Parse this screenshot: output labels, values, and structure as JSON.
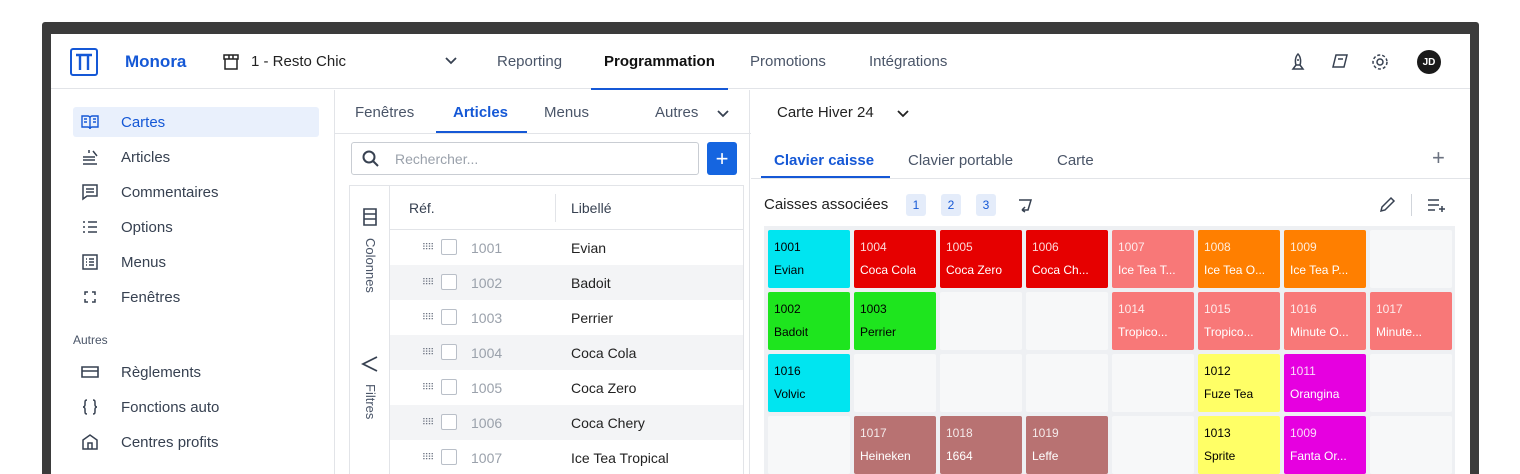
{
  "app": {
    "brand": "Monora",
    "store": "1 - Resto Chic",
    "avatar_initials": "JD"
  },
  "nav": [
    "Reporting",
    "Programmation",
    "Promotions",
    "Intégrations"
  ],
  "sidebar": {
    "items": [
      {
        "label": "Cartes",
        "icon": "book-open-icon",
        "active": true
      },
      {
        "label": "Articles",
        "icon": "dish-icon"
      },
      {
        "label": "Commentaires",
        "icon": "comment-icon"
      },
      {
        "label": "Options",
        "icon": "list-icon"
      },
      {
        "label": "Menus",
        "icon": "menu-card-icon"
      },
      {
        "label": "Fenêtres",
        "icon": "frame-corners-icon"
      }
    ],
    "section": "Autres",
    "other_items": [
      {
        "label": "Règlements",
        "icon": "credit-card-icon"
      },
      {
        "label": "Fonctions auto",
        "icon": "braces-icon"
      },
      {
        "label": "Centres profits",
        "icon": "building-icon"
      }
    ]
  },
  "middle": {
    "tabs": [
      "Fenêtres",
      "Articles",
      "Menus"
    ],
    "more_tab": "Autres",
    "search_placeholder": "Rechercher...",
    "columns_label": "Colonnes",
    "filters_label": "Filtres",
    "headers": {
      "ref": "Réf.",
      "label": "Libellé"
    },
    "rows": [
      {
        "ref": "1001",
        "label": "Evian"
      },
      {
        "ref": "1002",
        "label": "Badoit"
      },
      {
        "ref": "1003",
        "label": "Perrier"
      },
      {
        "ref": "1004",
        "label": "Coca Cola"
      },
      {
        "ref": "1005",
        "label": "Coca Zero"
      },
      {
        "ref": "1006",
        "label": "Coca Chery"
      },
      {
        "ref": "1007",
        "label": "Ice Tea Tropical"
      }
    ]
  },
  "right": {
    "menu_title": "Carte Hiver 24",
    "tabs": [
      "Clavier caisse",
      "Clavier portable",
      "Carte"
    ],
    "caisses_label": "Caisses associées",
    "caisses": [
      "1",
      "2",
      "3"
    ],
    "grid": [
      [
        {
          "code": "1001",
          "name": "Evian",
          "bg": "#00e5f0",
          "fg": "#000000"
        },
        {
          "code": "1004",
          "name": "Coca Cola",
          "bg": "#e60000",
          "fg": "#ffffff"
        },
        {
          "code": "1005",
          "name": "Coca Zero",
          "bg": "#e60000",
          "fg": "#ffffff"
        },
        {
          "code": "1006",
          "name": "Coca Ch...",
          "bg": "#e60000",
          "fg": "#ffffff"
        },
        {
          "code": "1007",
          "name": "Ice Tea T...",
          "bg": "#f87878",
          "fg": "#ffffff"
        },
        {
          "code": "1008",
          "name": "Ice Tea O...",
          "bg": "#ff7f00",
          "fg": "#ffffff"
        },
        {
          "code": "1009",
          "name": "Ice Tea P...",
          "bg": "#ff7f00",
          "fg": "#ffffff"
        },
        null
      ],
      [
        {
          "code": "1002",
          "name": "Badoit",
          "bg": "#1ee51e",
          "fg": "#000000"
        },
        {
          "code": "1003",
          "name": "Perrier",
          "bg": "#1ee51e",
          "fg": "#000000"
        },
        null,
        null,
        {
          "code": "1014",
          "name": "Tropico...",
          "bg": "#f87878",
          "fg": "#ffffff"
        },
        {
          "code": "1015",
          "name": "Tropico...",
          "bg": "#f87878",
          "fg": "#ffffff"
        },
        {
          "code": "1016",
          "name": "Minute O...",
          "bg": "#f87878",
          "fg": "#ffffff"
        },
        {
          "code": "1017",
          "name": "Minute...",
          "bg": "#f87878",
          "fg": "#ffffff"
        }
      ],
      [
        {
          "code": "1016",
          "name": "Volvic",
          "bg": "#00e5f0",
          "fg": "#000000"
        },
        null,
        null,
        null,
        null,
        {
          "code": "1012",
          "name": "Fuze Tea",
          "bg": "#ffff66",
          "fg": "#000000"
        },
        {
          "code": "1011",
          "name": "Orangina",
          "bg": "#e600e0",
          "fg": "#ffffff"
        },
        null
      ],
      [
        null,
        {
          "code": "1017",
          "name": "Heineken",
          "bg": "#b87272",
          "fg": "#ffffff"
        },
        {
          "code": "1018",
          "name": "1664",
          "bg": "#b87272",
          "fg": "#ffffff"
        },
        {
          "code": "1019",
          "name": "Leffe",
          "bg": "#b87272",
          "fg": "#ffffff"
        },
        null,
        {
          "code": "1013",
          "name": "Sprite",
          "bg": "#ffff66",
          "fg": "#000000"
        },
        {
          "code": "1009",
          "name": "Fanta Or...",
          "bg": "#e600e0",
          "fg": "#ffffff"
        },
        null
      ]
    ]
  },
  "colors": {
    "accent": "#1558d6"
  }
}
